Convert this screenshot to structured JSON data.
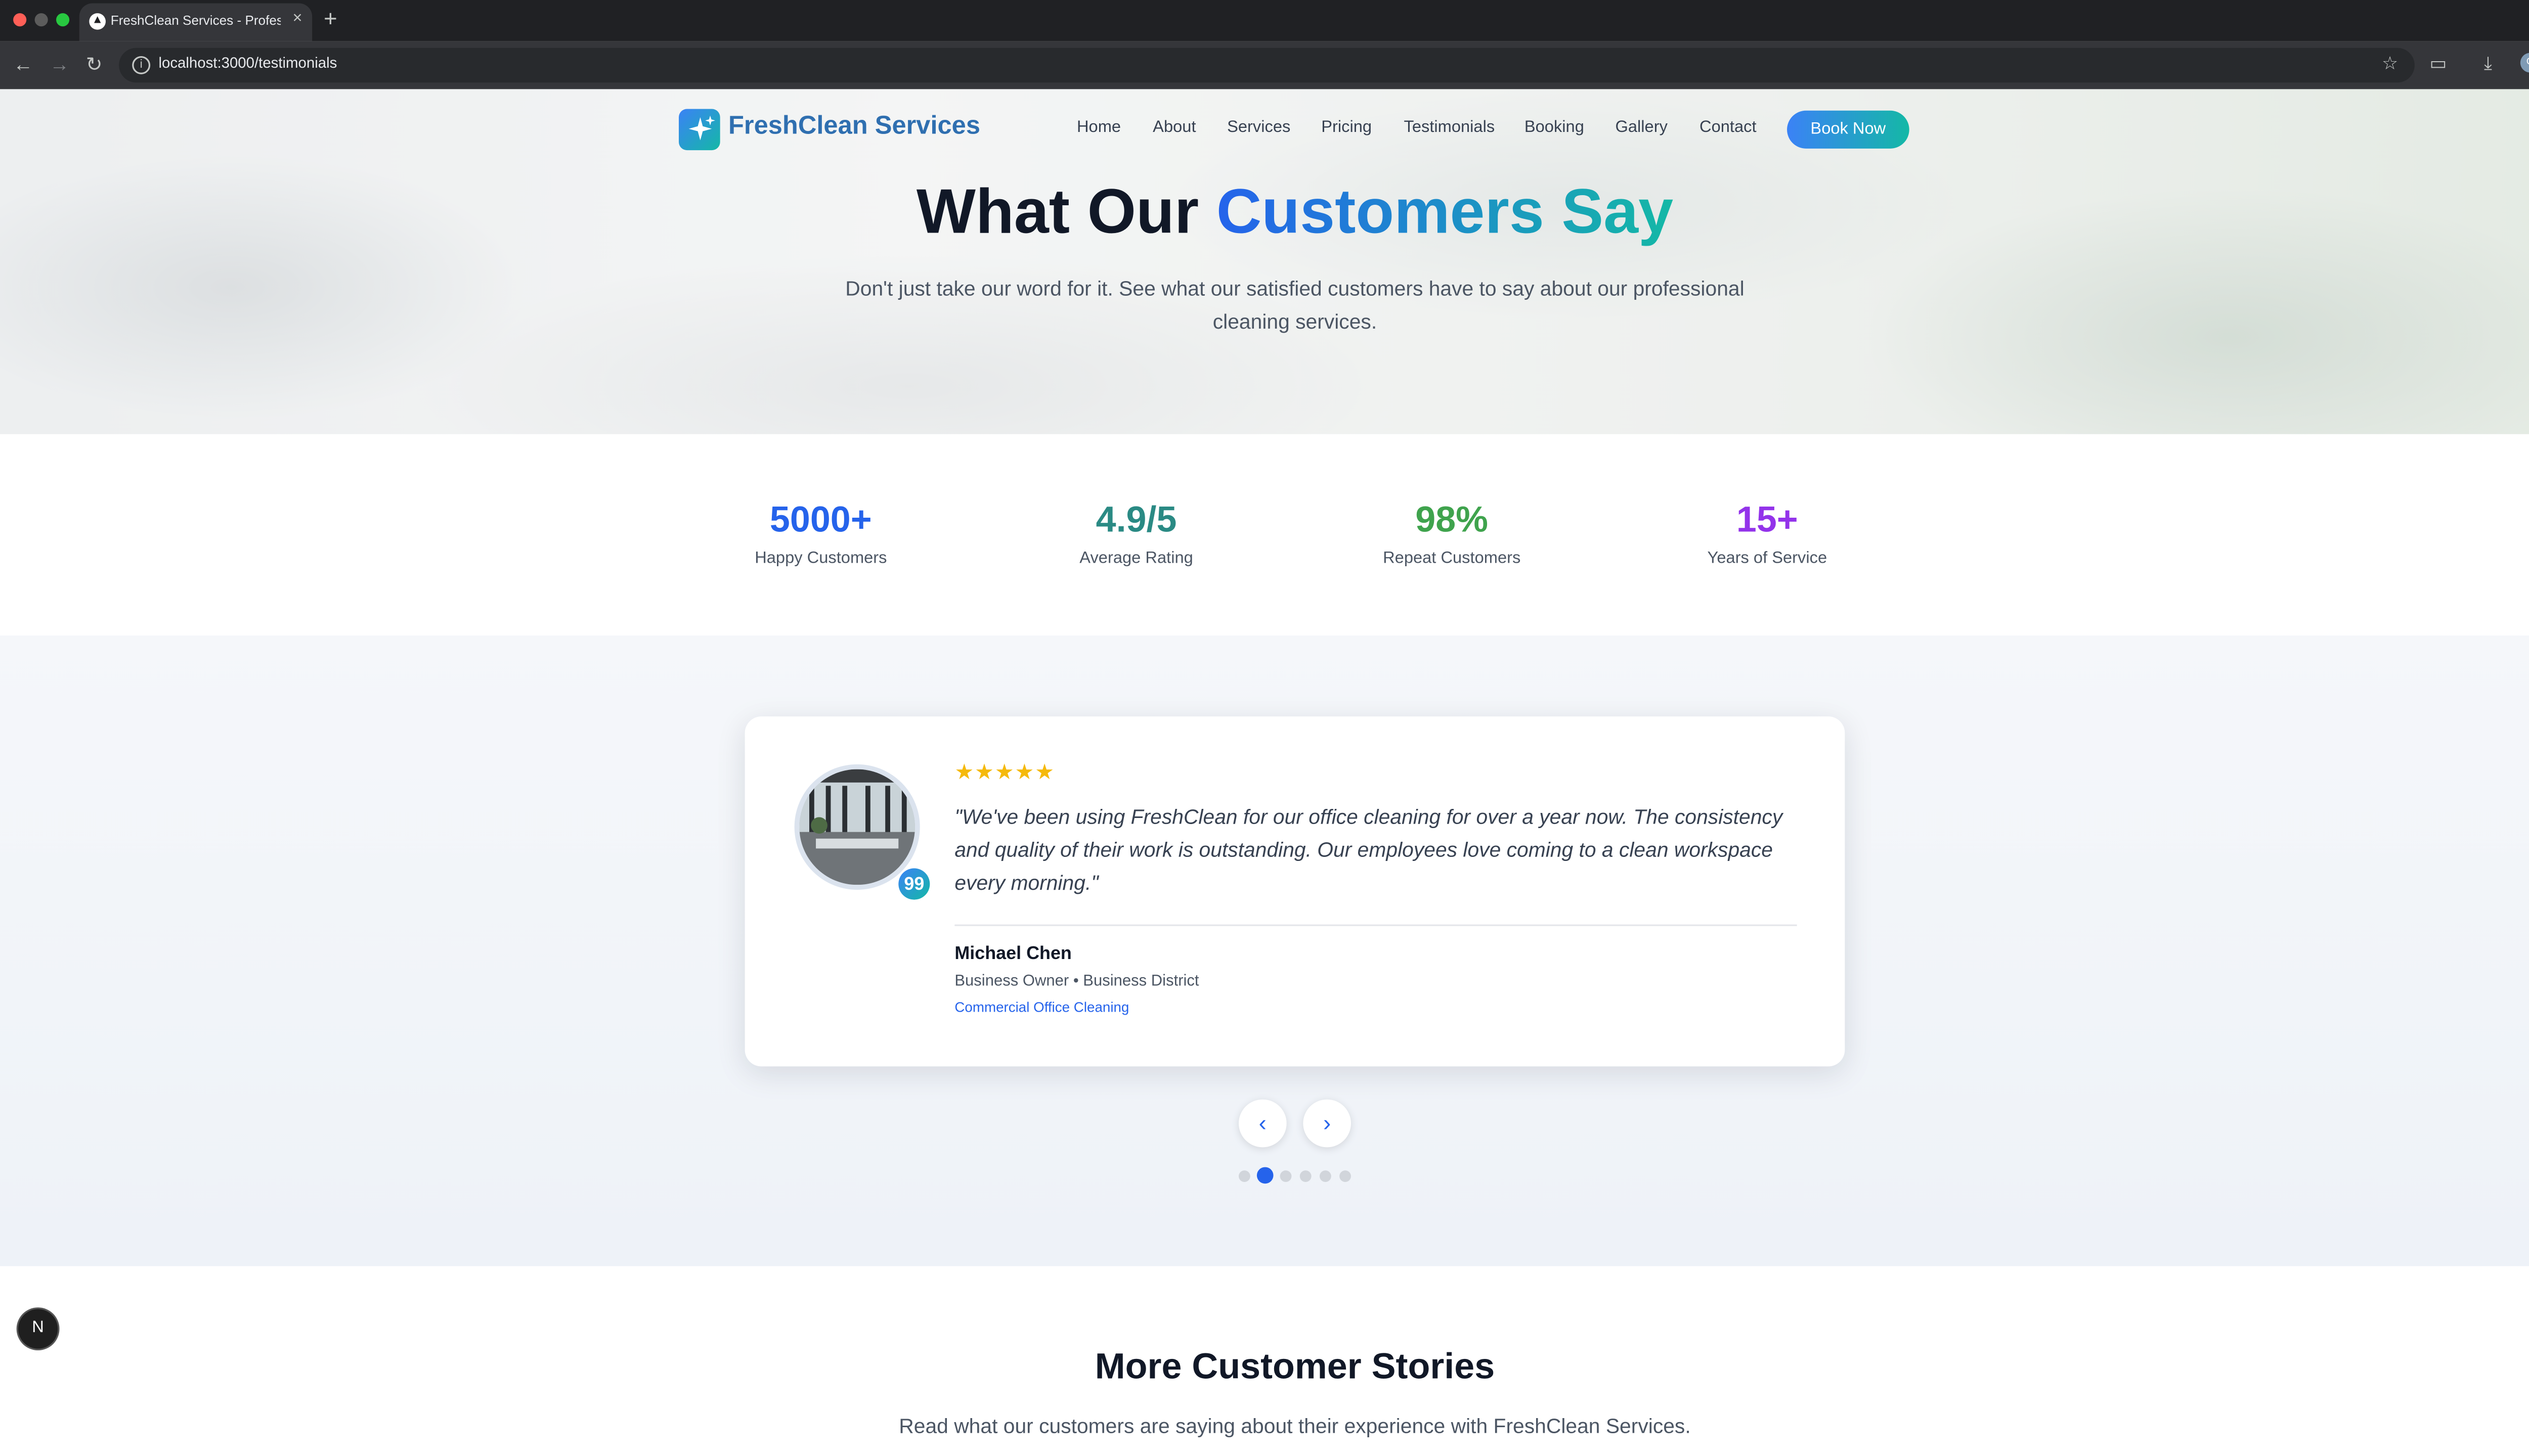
{
  "browser": {
    "tab_title": "FreshClean Services - Profes",
    "tab_favicon": "▲",
    "url": "localhost:3000/testimonials",
    "profile_initial": "G"
  },
  "nav": {
    "brand": "FreshClean Services",
    "links": [
      "Home",
      "About",
      "Services",
      "Pricing",
      "Testimonials",
      "Booking",
      "Gallery",
      "Contact"
    ],
    "cta": "Book Now"
  },
  "hero": {
    "title_plain": "What Our",
    "title_highlight": "Customers Say",
    "subtitle": "Don't just take our word for it. See what our satisfied customers have to say about our professional cleaning services."
  },
  "stats": [
    {
      "value": "5000+",
      "label": "Happy Customers",
      "color": "#2563eb"
    },
    {
      "value": "4.9/5",
      "label": "Average Rating",
      "color": "#2a8a84"
    },
    {
      "value": "98%",
      "label": "Repeat Customers",
      "color": "#3fa34d"
    },
    {
      "value": "15+",
      "label": "Years of Service",
      "color": "#9333ea"
    }
  ],
  "testimonial": {
    "rating": 5,
    "stars": "★★★★★",
    "quote": "\"We've been using FreshClean for our office cleaning for over a year now. The consistency and quality of their work is outstanding. Our employees love coming to a clean workspace every morning.\"",
    "quote_icon": "99",
    "name": "Michael Chen",
    "role": "Business Owner • Business District",
    "service": "Commercial Office Cleaning"
  },
  "carousel": {
    "prev_icon": "‹",
    "next_icon": "›",
    "total_slides": 6,
    "active_slide": 2
  },
  "more_stories": {
    "title": "More Customer Stories",
    "subtitle": "Read what our customers are saying about their experience with FreshClean Services."
  },
  "dev_badge": "N",
  "colors": {
    "accent_blue": "#3b82f6",
    "accent_teal": "#14b8a6",
    "star_gold": "#f5b90b"
  }
}
